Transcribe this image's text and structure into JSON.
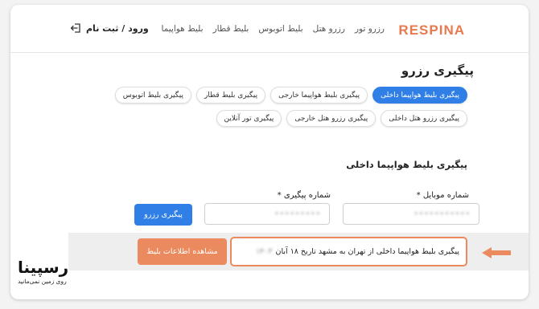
{
  "header": {
    "logo": "RESPINA",
    "nav": [
      "بلیط هواپیما",
      "بلیط قطار",
      "بلیط اتوبوس",
      "رزرو هتل",
      "رزرو تور"
    ],
    "login_label": "ورود / ثبت نام",
    "login_icon": "login-arrow-icon"
  },
  "page": {
    "title": "پیگیری رزرو",
    "tabs_row1": [
      "پیگیری بلیط هواپیما داخلی",
      "پیگیری بلیط هواپیما خارجی",
      "پیگیری بلیط قطار",
      "پیگیری بلیط اتوبوس"
    ],
    "tabs_row2": [
      "پیگیری رزرو هتل داخلی",
      "پیگیری رزرو هتل خارجی",
      "پیگیری تور آنلاین"
    ],
    "active_tab": "پیگیری بلیط هواپیما داخلی"
  },
  "form": {
    "section_title": "پیگیری بلیط هواپیما داخلی",
    "mobile_label": "شماره موبایل *",
    "mobile_value": "•••••••••••",
    "tracking_label": "شماره پیگیری *",
    "tracking_value": "•••••••••",
    "submit_label": "پیگیری رزرو"
  },
  "result": {
    "text": "پیگیری بلیط هواپیما داخلی  از  تهران  به  مشهد  تاریخ  ۱۸ آبان",
    "year_hidden": "۱۴۰۳",
    "view_label": "مشاهده اطلاعات بلیط"
  },
  "brand": {
    "wordmark": "رسپینا",
    "tagline": "روی زمین نمی‌مانید"
  },
  "colors": {
    "accent_blue": "#2f7fe6",
    "accent_orange": "#ea8a5e",
    "logo_orange": "#e8794f"
  }
}
